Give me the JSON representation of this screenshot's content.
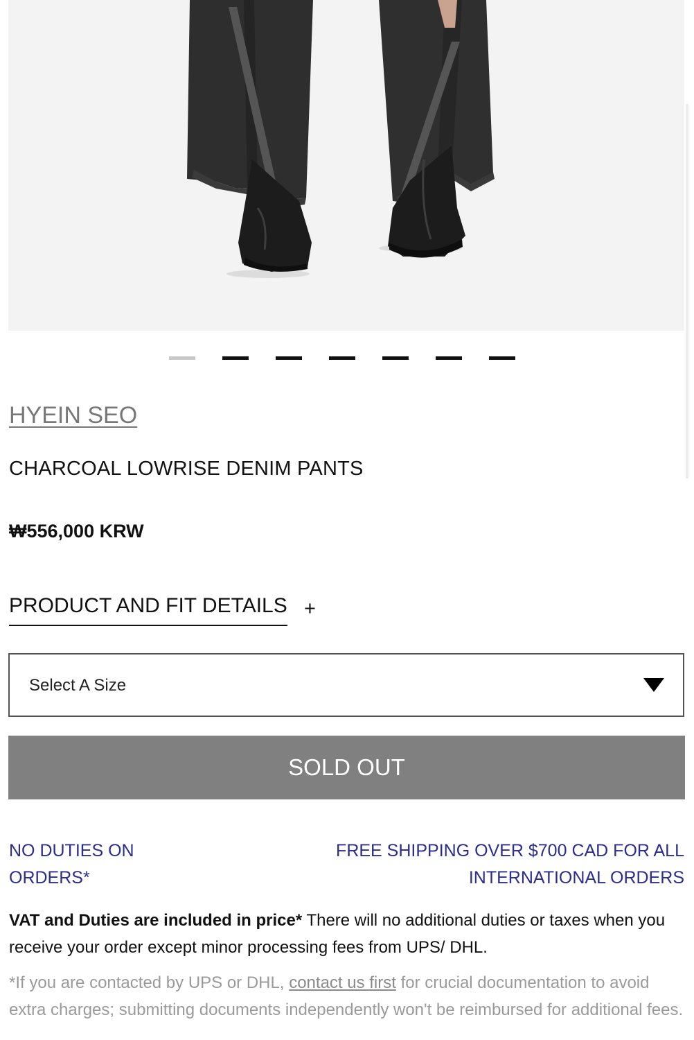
{
  "product_image": {
    "alt": "CHARCOAL LOWRISE DENIM PANTS"
  },
  "carousel": {
    "count": 7,
    "active_index": 0
  },
  "brand": "HYEIN SEO",
  "product_title": "CHARCOAL LOWRISE DENIM PANTS",
  "price": "₩556,000 KRW",
  "details": {
    "label": "PRODUCT AND FIT DETAILS",
    "toggle": "+"
  },
  "size_select": {
    "selected": "Select A Size",
    "icon": "caret-down-icon"
  },
  "sold_out_button": "SOLD OUT",
  "notices": {
    "left": "NO DUTIES ON ORDERS*",
    "right": "FREE SHIPPING OVER $700 CAD FOR ALL INTERNATIONAL ORDERS"
  },
  "vat_note": {
    "bold": "VAT and Duties are included in price*",
    "text": " There will no additional duties or taxes when you receive your order except minor processing fees from UPS/ DHL."
  },
  "fine_print": {
    "prefix": "*If you are contacted by UPS or DHL, ",
    "link": "contact us first",
    "suffix": " for crucial documentation to avoid extra charges; submitting documents independently won't be reimbursed for additional fees."
  },
  "colors": {
    "accent_blue": "#2b2d8f",
    "button_gray": "#808080",
    "brand_gray": "#777777"
  }
}
